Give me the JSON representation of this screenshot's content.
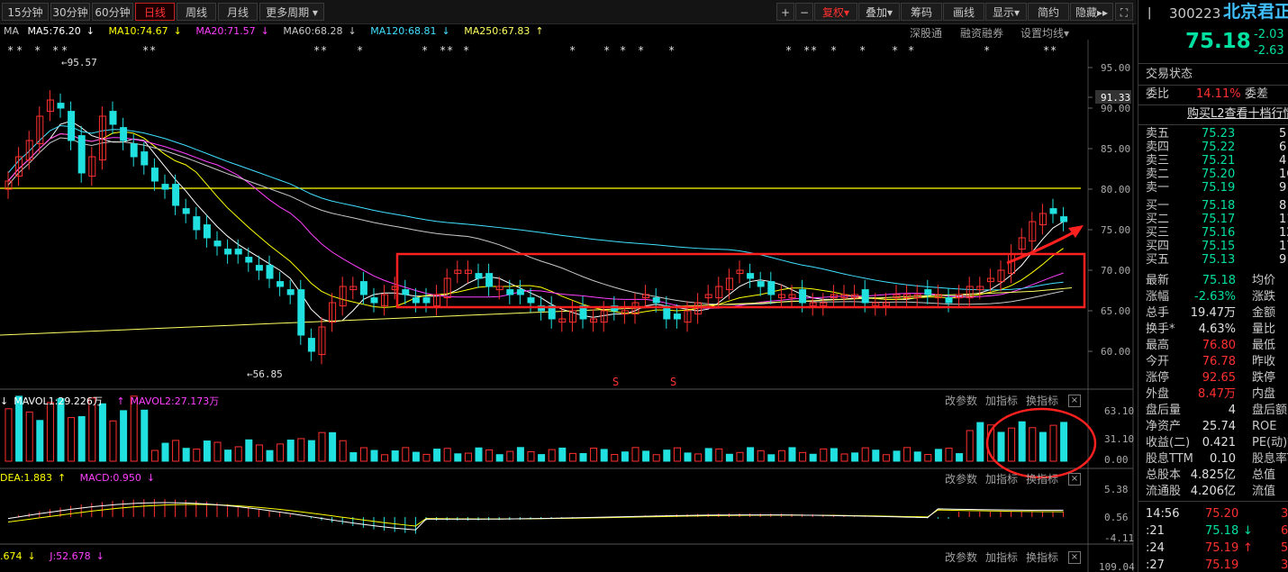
{
  "toolbar": {
    "periods": [
      "15分钟",
      "30分钟",
      "60分钟",
      "日线",
      "周线",
      "月线",
      "更多周期"
    ],
    "active_period": "日线",
    "right_buttons": [
      "+",
      "−",
      "复权",
      "叠加",
      "筹码",
      "画线",
      "显示",
      "简约",
      "隐藏"
    ]
  },
  "ma_legend": {
    "label": "MA",
    "items": [
      {
        "text": "MA5:76.20",
        "arrow": "↓",
        "color": "#ffffff"
      },
      {
        "text": "MA10:74.67",
        "arrow": "↓",
        "color": "#ffff00"
      },
      {
        "text": "MA20:71.57",
        "arrow": "↓",
        "color": "#ff40ff"
      },
      {
        "text": "MA60:68.28",
        "arrow": "↓",
        "color": "#c8c8c8"
      },
      {
        "text": "MA120:68.81",
        "arrow": "↓",
        "color": "#40e0ff"
      },
      {
        "text": "MA250:67.83",
        "arrow": "↑",
        "color": "#ffff60"
      }
    ],
    "links": [
      "深股通",
      "融资融券",
      "设置均线"
    ]
  },
  "price_axis": [
    "95.00",
    "91.33",
    "90.00",
    "85.00",
    "80.00",
    "75.00",
    "70.00",
    "65.00",
    "60.00"
  ],
  "price_marks": {
    "high": "95.57",
    "low": "56.85"
  },
  "vol_legend": {
    "items": [
      {
        "text": "MAVOL1:29.226万",
        "arrow": "↓",
        "color": "#ffffff"
      },
      {
        "text": "MAVOL2:27.173万",
        "arrow": "↑",
        "color": "#ff40ff"
      }
    ],
    "axis": [
      "63.10",
      "31.10",
      "0.00"
    ]
  },
  "macd_legend": {
    "items": [
      {
        "text": "DEA:1.883",
        "arrow": "↑",
        "color": "#ffff00"
      },
      {
        "text": "MACD:0.950",
        "arrow": "↓",
        "color": "#ff40ff"
      }
    ],
    "axis": [
      "5.38",
      "0.56",
      "-4.11"
    ]
  },
  "kdj_legend": {
    "items": [
      {
        "text": ".674",
        "arrow": "↓",
        "color": "#ffff00"
      },
      {
        "text": "J:52.678",
        "arrow": "↓",
        "color": "#ff40ff"
      }
    ],
    "axis": [
      "109.04"
    ]
  },
  "panel_tools": [
    "改参数",
    "加指标",
    "换指标"
  ],
  "stock": {
    "code": "300223",
    "name": "北京君正",
    "price": "75.18",
    "change": "-2.03",
    "change_pct": "-2.63"
  },
  "quote": {
    "status_label": "交易状态",
    "weibi_label": "委比",
    "weibi": "14.11%",
    "weicha_label": "委差",
    "l2_link": "购买L2查看十档行情",
    "asks": [
      {
        "label": "卖五",
        "price": "75.23",
        "vol": "5"
      },
      {
        "label": "卖四",
        "price": "75.22",
        "vol": "6"
      },
      {
        "label": "卖三",
        "price": "75.21",
        "vol": "4"
      },
      {
        "label": "卖二",
        "price": "75.20",
        "vol": "16"
      },
      {
        "label": "卖一",
        "price": "75.19",
        "vol": "9"
      }
    ],
    "bids": [
      {
        "label": "买一",
        "price": "75.18",
        "vol": "8"
      },
      {
        "label": "买二",
        "price": "75.17",
        "vol": "11"
      },
      {
        "label": "买三",
        "price": "75.16",
        "vol": "12"
      },
      {
        "label": "买四",
        "price": "75.15",
        "vol": "17"
      },
      {
        "label": "买五",
        "price": "75.13",
        "vol": "9"
      }
    ],
    "stats": [
      {
        "l": "最新",
        "v": "75.18",
        "vc": "grn",
        "r": "均价"
      },
      {
        "l": "涨幅",
        "v": "-2.63%",
        "vc": "grn",
        "r": "涨跌"
      },
      {
        "l": "总手",
        "v": "19.47万",
        "vc": "wht",
        "r": "金额"
      },
      {
        "l": "换手*",
        "v": "4.63%",
        "vc": "wht",
        "r": "量比"
      },
      {
        "l": "最高",
        "v": "76.80",
        "vc": "red",
        "r": "最低"
      },
      {
        "l": "今开",
        "v": "76.78",
        "vc": "red",
        "r": "昨收"
      },
      {
        "l": "涨停",
        "v": "92.65",
        "vc": "red",
        "r": "跌停"
      },
      {
        "l": "外盘",
        "v": "8.47万",
        "vc": "red",
        "r": "内盘"
      },
      {
        "l": "盘后量",
        "v": "4",
        "vc": "wht",
        "r": "盘后额"
      },
      {
        "l": "净资产",
        "v": "25.74",
        "vc": "wht",
        "r": "ROE"
      },
      {
        "l": "收益(二)",
        "v": "0.421",
        "vc": "wht",
        "r": "PE(动)*"
      },
      {
        "l": "股息TTM",
        "v": "0.10",
        "vc": "wht",
        "r": "股息率T"
      },
      {
        "l": "总股本",
        "v": "4.825亿",
        "vc": "wht",
        "r": "总值"
      },
      {
        "l": "流通股",
        "v": "4.206亿",
        "vc": "wht",
        "r": "流值"
      }
    ],
    "ticks": [
      {
        "t": "14:56",
        "p": "75.20",
        "pc": "red",
        "a": "",
        "ac": "",
        "v": "3"
      },
      {
        "t": ":21",
        "p": "75.18",
        "pc": "grn",
        "a": "↓",
        "ac": "grn",
        "v": "6"
      },
      {
        "t": ":24",
        "p": "75.19",
        "pc": "red",
        "a": "↑",
        "ac": "red",
        "v": "5"
      },
      {
        "t": ":27",
        "p": "75.19",
        "pc": "red",
        "a": "",
        "ac": "",
        "v": "3"
      }
    ]
  },
  "chart_data": {
    "type": "candlestick",
    "close": [
      81,
      84,
      86,
      89,
      91,
      90,
      86,
      82,
      84,
      89,
      88,
      86,
      84,
      83,
      81,
      80,
      78,
      77,
      75,
      74,
      73,
      72,
      72,
      71,
      70,
      69,
      68,
      67,
      62,
      60,
      63,
      66,
      68,
      68,
      67,
      66,
      67,
      68,
      67,
      66,
      66,
      67,
      69,
      70,
      70,
      69,
      68,
      68,
      67,
      67,
      66,
      65,
      64,
      64,
      65,
      64,
      64,
      65,
      65,
      65,
      66,
      67,
      66,
      64,
      64,
      65,
      66,
      67,
      68,
      69,
      70,
      69,
      68,
      67,
      67,
      67,
      66,
      66,
      66,
      67,
      67,
      67,
      66,
      66,
      66,
      67,
      67,
      67,
      67,
      67,
      66,
      67,
      68,
      68,
      69,
      70,
      72,
      74,
      76,
      77,
      77,
      76
    ],
    "ma250": [
      62,
      62.2,
      62.4,
      62.6,
      62.8,
      63,
      63.2,
      63.4,
      63.6,
      63.8,
      64,
      64.2,
      64.4,
      64.6,
      64.8,
      65,
      65.2,
      65.4,
      65.6,
      65.8,
      66,
      66.2,
      66.4,
      66.6,
      66.8,
      67,
      67.2,
      67.4,
      67.83
    ],
    "horizontal_line": 80,
    "annotation": "consolidation box 65-72"
  }
}
